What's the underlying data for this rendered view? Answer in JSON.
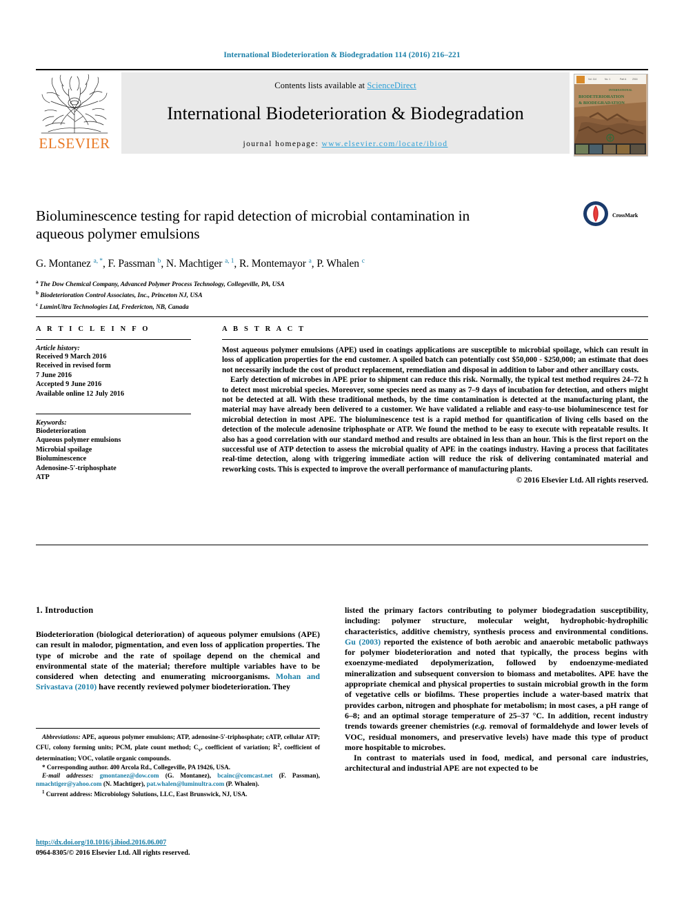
{
  "running_head": "International Biodeterioration & Biodegradation 114 (2016) 216–221",
  "masthead": {
    "contents_prefix": "Contents lists available at ",
    "sciencedirect": "ScienceDirect",
    "journal_title": "International Biodeterioration & Biodegradation",
    "homepage_prefix": "journal homepage: ",
    "homepage_url": "www.elsevier.com/locate/ibiod",
    "publisher": "ELSEVIER",
    "cover_title_line1": "INTERNATIONAL",
    "cover_title_line2": "BIODETERIORATION",
    "cover_title_line3": "& BIODEGRADATION",
    "accent_link_color": "#2a9fd6",
    "publisher_color": "#e87722"
  },
  "article": {
    "title": "Bioluminescence testing for rapid detection of microbial contamination in aqueous polymer emulsions",
    "crossmark_label": "CrossMark",
    "authors_html": "G. Montanez <sup class=\"star\">a, *</sup>, F. Passman <sup>b</sup>, N. Machtiger <sup>a, 1</sup>, R. Montemayor <sup>a</sup>, P. Whalen <sup>c</sup>",
    "affiliations": [
      {
        "marker": "a",
        "text": "The Dow Chemical Company, Advanced Polymer Process Technology, Collegeville, PA, USA"
      },
      {
        "marker": "b",
        "text": "Biodeterioration Control Associates, Inc., Princeton NJ, USA"
      },
      {
        "marker": "c",
        "text": "LuminUltra Technologies Ltd, Fredericton, NB, Canada"
      }
    ]
  },
  "article_info": {
    "heading": "A R T I C L E   I N F O",
    "history_label": "Article history:",
    "history": [
      "Received 9 March 2016",
      "Received in revised form",
      "7 June 2016",
      "Accepted 9 June 2016",
      "Available online 12 July 2016"
    ],
    "keywords_label": "Keywords:",
    "keywords": [
      "Biodeterioration",
      "Aqueous polymer emulsions",
      "Microbial spoilage",
      "Bioluminescence",
      "Adenosine-5'-triphosphate",
      "ATP"
    ]
  },
  "abstract": {
    "heading": "A B S T R A C T",
    "paragraphs": [
      "Most aqueous polymer emulsions (APE) used in coatings applications are susceptible to microbial spoilage, which can result in loss of application properties for the end customer. A spoiled batch can potentially cost $50,000 - $250,000; an estimate that does not necessarily include the cost of product replacement, remediation and disposal in addition to labor and other ancillary costs.",
      "Early detection of microbes in APE prior to shipment can reduce this risk. Normally, the typical test method requires 24–72 h to detect most microbial species. Moreover, some species need as many as 7–9 days of incubation for detection, and others might not be detected at all. With these traditional methods, by the time contamination is detected at the manufacturing plant, the material may have already been delivered to a customer. We have validated a reliable and easy-to-use bioluminescence test for microbial detection in most APE. The bioluminescence test is a rapid method for quantification of living cells based on the detection of the molecule adenosine triphosphate or ATP. We found the method to be easy to execute with repeatable results. It also has a good correlation with our standard method and results are obtained in less than an hour. This is the first report on the successful use of ATP detection to assess the microbial quality of APE in the coatings industry. Having a process that facilitates real-time detection, along with triggering immediate action will reduce the risk of delivering contaminated material and reworking costs. This is expected to improve the overall performance of manufacturing plants."
    ],
    "copyright": "© 2016 Elsevier Ltd. All rights reserved."
  },
  "introduction": {
    "heading": "1. Introduction",
    "left_paragraph_html": "Biodeterioration (biological deterioration) of aqueous polymer emulsions (APE) can result in malodor, pigmentation, and even loss of application properties. The type of microbe and the rate of spoilage depend on the chemical and environmental state of the material; therefore multiple variables have to be considered when detecting and enumerating microorganisms. <span class=\"cite\">Mohan and Srivastava (2010)</span> have recently reviewed polymer biodeterioration. They",
    "right_paragraph1_html": "listed the primary factors contributing to polymer biodegradation susceptibility, including: polymer structure, molecular weight, hydrophobic-hydrophilic characteristics, additive chemistry, synthesis process and environmental conditions. <span class=\"cite\">Gu (2003)</span> reported the existence of both aerobic and anaerobic metabolic pathways for polymer biodeterioration and noted that typically, the process begins with exoenzyme-mediated depolymerization, followed by endoenzyme-mediated mineralization and subsequent conversion to biomass and metabolites. APE have the appropriate chemical and physical properties to sustain microbial growth in the form of vegetative cells or biofilms. These properties include a water-based matrix that provides carbon, nitrogen and phosphate for metabolism; in most cases, a pH range of 6–8; and an optimal storage temperature of 25–37 °C. In addition, recent industry trends towards greener chemistries (<em>e.g.</em> removal of formaldehyde and lower levels of VOC, residual monomers, and preservative levels) have made this type of product more hospitable to microbes.",
    "right_paragraph2_html": "In contrast to materials used in food, medical, and personal care industries, architectural and industrial APE are not expected to be"
  },
  "footnotes": {
    "abbreviations_html": "<em>Abbreviations:</em> APE, aqueous polymer emulsions; ATP, adenosine-5'-triphosphate; cATP, cellular ATP; CFU, colony forming units; PCM, plate count method; C<sub>v</sub>, coefficient of variation; R<sup>2</sup>, coefficient of determination; VOC, volatile organic compounds.",
    "corresponding_html": "* Corresponding author. 400 Arcola Rd., Collegeville, PA 19426, USA.",
    "emails_html": "<em>E-mail addresses:</em> <span class=\"mail\">gmontanez@dow.com</span> (G. Montanez), <span class=\"mail\">bcainc@comcast.net</span> (F. Passman), <span class=\"mail\">nmachtiger@yahoo.com</span> (N. Machtiger), <span class=\"mail\">pat.whalen@luminultra.com</span> (P. Whalen).",
    "current_address_html": "<sup>1</sup> Current address: Microbiology Solutions, LLC, East Brunswick, NJ, USA."
  },
  "footer": {
    "doi": "http://dx.doi.org/10.1016/j.ibiod.2016.06.007",
    "issn_line": "0964-8305/© 2016 Elsevier Ltd. All rights reserved."
  }
}
